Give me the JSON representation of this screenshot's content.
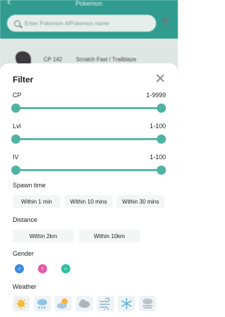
{
  "background": {
    "title": "Pokemon",
    "search_placeholder": "Enter Pokemon #/Pokemon name",
    "card": {
      "cp": "CP 142",
      "moves": "Scratch Fast / Trailblaze"
    }
  },
  "filter": {
    "title": "Filter",
    "cp": {
      "label": "CP",
      "range": "1-9999",
      "min_fraction": 0,
      "max_fraction": 1
    },
    "lvl": {
      "label": "Lvl",
      "range": "1-100",
      "min_fraction": 0,
      "max_fraction": 1
    },
    "iv": {
      "label": "IV",
      "range": "1-100",
      "min_fraction": 0,
      "max_fraction": 1
    },
    "spawn_time": {
      "label": "Spawn time",
      "options": [
        "Within 1 min",
        "Within 10 mins",
        "Within 30 mins"
      ]
    },
    "distance": {
      "label": "Distance",
      "options": [
        "Within 2km",
        "Within 10km"
      ]
    },
    "gender": {
      "label": "Gender",
      "options": [
        {
          "symbol": "♂",
          "icon": "male-icon",
          "color": "#3d8be0"
        },
        {
          "symbol": "♀",
          "icon": "female-icon",
          "color": "#e25ca7"
        },
        {
          "symbol": "○",
          "icon": "genderless-icon",
          "color": "#2fbfa5"
        }
      ]
    },
    "weather": {
      "label": "Weather",
      "options": [
        "sunny-icon",
        "rain-icon",
        "partly-cloudy-icon",
        "cloudy-icon",
        "windy-icon",
        "snow-icon",
        "fog-icon"
      ]
    }
  },
  "colors": {
    "accent": "#4fb3a2",
    "header": "#2f9c8f"
  }
}
